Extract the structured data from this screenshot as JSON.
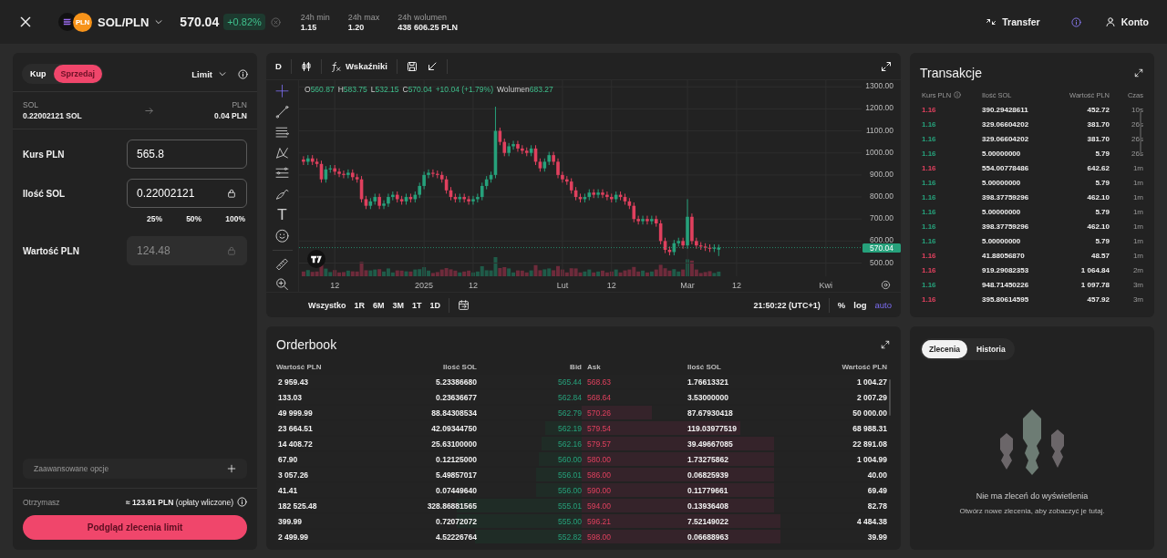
{
  "header": {
    "pair": "SOL/PLN",
    "quote_badge": "PLN",
    "price": "570.04",
    "change": "+0.82%",
    "stats": [
      {
        "label": "24h min",
        "value": "1.15"
      },
      {
        "label": "24h max",
        "value": "1.20"
      },
      {
        "label": "24h wolumen",
        "value": "438 606.25 PLN"
      }
    ],
    "actions": [
      {
        "kind": "transfer",
        "label": "Transfer"
      },
      {
        "kind": "info"
      },
      {
        "kind": "account",
        "label": "Konto"
      }
    ]
  },
  "order_form": {
    "sides": [
      {
        "label": "Kup",
        "selected": false
      },
      {
        "label": "Sprzedaj",
        "selected": true
      }
    ],
    "order_type": "Limit",
    "from": {
      "asset": "SOL",
      "balance": "0.22002121 SOL"
    },
    "to": {
      "asset": "PLN",
      "balance": "0.04 PLN"
    },
    "fields": [
      {
        "label": "Kurs PLN",
        "value": "565.8",
        "locked": false,
        "disabled": false
      },
      {
        "label": "Ilość SOL",
        "value": "0.22002121",
        "locked": true,
        "disabled": false,
        "presets": [
          "25%",
          "50%",
          "100%"
        ]
      },
      {
        "label": "Wartość PLN",
        "value": "124.48",
        "locked": true,
        "disabled": true
      }
    ],
    "advanced": "Zaawansowane opcje",
    "receive_label": "Otrzymasz",
    "receive_value": "**≈ 123.91 PLN** (opłaty wliczone)",
    "submit": "Podgląd zlecenia limit"
  },
  "chart": {
    "toolbar": {
      "interval": "D",
      "indicators": "Wskaźniki"
    },
    "text_tool": "T",
    "legend": [
      {
        "label": "O",
        "value": "560.87"
      },
      {
        "label": "H",
        "value": "583.75"
      },
      {
        "label": "L",
        "value": "532.15"
      },
      {
        "label": "C",
        "value": "570.04"
      }
    ],
    "legend_change": "+10.04 (+1.79%)",
    "volume_label": "Wolumen",
    "volume_value": "683.27",
    "chart_data": {
      "type": "candlestick",
      "grid": true,
      "ylim": [
        440,
        1330
      ],
      "yticks": [
        {
          "value": 500,
          "label": "500.00"
        },
        {
          "value": 600,
          "label": "600.00"
        },
        {
          "value": 700,
          "label": "700.00"
        },
        {
          "value": 800,
          "label": "800.00"
        },
        {
          "value": 900,
          "label": "900.00"
        },
        {
          "value": 1000,
          "label": "1000.00"
        },
        {
          "value": 1100,
          "label": "1100.00"
        },
        {
          "value": 1200,
          "label": "1200.00"
        },
        {
          "value": 1300,
          "label": "1300.00"
        }
      ],
      "ref_lines": [
        {
          "axis": "y",
          "value": 570.04,
          "label": "570.04"
        }
      ],
      "categories": [
        null,
        null,
        null,
        null,
        null,
        null,
        null,
        null,
        "12",
        null,
        null,
        null,
        null,
        null,
        null,
        null,
        null,
        null,
        null,
        null,
        null,
        null,
        null,
        null,
        null,
        null,
        null,
        null,
        "2025",
        null,
        null,
        null,
        null,
        null,
        null,
        null,
        null,
        null,
        null,
        "12",
        null,
        null,
        null,
        null,
        null,
        null,
        null,
        null,
        null,
        null,
        null,
        null,
        null,
        null,
        null,
        null,
        null,
        null,
        null,
        "Lut",
        null,
        null,
        null,
        null,
        null,
        null,
        null,
        null,
        null,
        null,
        "12",
        null,
        null,
        null,
        null,
        null,
        null,
        null,
        null,
        null,
        null,
        null,
        null,
        null,
        null,
        null,
        null,
        "Mar",
        null,
        null,
        null,
        null,
        null,
        null,
        null,
        null,
        null,
        null,
        "12",
        null,
        null,
        null,
        null,
        null,
        null,
        null,
        null,
        null,
        null,
        null,
        null,
        null,
        null,
        null,
        null,
        null,
        null,
        null,
        "Kwi",
        null,
        null,
        null,
        null,
        null,
        null,
        null
      ],
      "ohlc": [
        null,
        [
          970,
          985,
          945,
          960
        ],
        [
          960,
          990,
          945,
          975
        ],
        [
          975,
          990,
          945,
          960
        ],
        [
          960,
          975,
          935,
          950
        ],
        [
          950,
          965,
          865,
          880
        ],
        [
          880,
          940,
          865,
          925
        ],
        [
          925,
          945,
          910,
          930
        ],
        [
          930,
          945,
          900,
          915
        ],
        [
          915,
          930,
          890,
          905
        ],
        [
          905,
          920,
          885,
          900
        ],
        [
          900,
          925,
          885,
          910
        ],
        [
          910,
          925,
          875,
          890
        ],
        [
          890,
          905,
          865,
          880
        ],
        [
          880,
          895,
          775,
          790
        ],
        [
          790,
          805,
          745,
          760
        ],
        [
          760,
          795,
          745,
          780
        ],
        [
          780,
          815,
          765,
          800
        ],
        [
          800,
          815,
          745,
          760
        ],
        [
          760,
          785,
          745,
          770
        ],
        [
          770,
          815,
          755,
          800
        ],
        [
          800,
          825,
          785,
          810
        ],
        [
          810,
          825,
          775,
          790
        ],
        [
          790,
          805,
          765,
          780
        ],
        [
          780,
          815,
          765,
          800
        ],
        [
          800,
          815,
          775,
          790
        ],
        [
          790,
          825,
          775,
          810
        ],
        [
          810,
          865,
          795,
          850
        ],
        [
          850,
          915,
          835,
          900
        ],
        [
          900,
          925,
          885,
          910
        ],
        [
          910,
          925,
          890,
          905
        ],
        [
          905,
          920,
          885,
          900
        ],
        [
          900,
          915,
          865,
          880
        ],
        [
          880,
          895,
          815,
          830
        ],
        [
          830,
          845,
          785,
          800
        ],
        [
          800,
          815,
          775,
          790
        ],
        [
          790,
          815,
          775,
          800
        ],
        [
          800,
          815,
          775,
          790
        ],
        [
          790,
          805,
          765,
          780
        ],
        [
          780,
          805,
          765,
          790
        ],
        [
          790,
          815,
          775,
          800
        ],
        [
          800,
          865,
          785,
          850
        ],
        [
          850,
          895,
          835,
          880
        ],
        [
          880,
          915,
          865,
          900
        ],
        [
          900,
          1210,
          885,
          1100
        ],
        [
          1100,
          1115,
          1035,
          1050
        ],
        [
          1050,
          1065,
          985,
          1000
        ],
        [
          1000,
          1045,
          985,
          1030
        ],
        [
          1030,
          1055,
          1015,
          1040
        ],
        [
          1040,
          1055,
          1005,
          1020
        ],
        [
          1020,
          1035,
          995,
          1010
        ],
        [
          1010,
          1025,
          985,
          1000
        ],
        [
          1000,
          1035,
          985,
          1020
        ],
        [
          1020,
          1035,
          945,
          960
        ],
        [
          960,
          975,
          915,
          930
        ],
        [
          930,
          975,
          915,
          960
        ],
        [
          960,
          1005,
          945,
          990
        ],
        [
          990,
          1005,
          945,
          960
        ],
        [
          960,
          975,
          885,
          900
        ],
        [
          900,
          915,
          865,
          880
        ],
        [
          880,
          895,
          855,
          870
        ],
        [
          870,
          885,
          815,
          830
        ],
        [
          830,
          845,
          785,
          800
        ],
        [
          800,
          815,
          775,
          790
        ],
        [
          790,
          815,
          775,
          800
        ],
        [
          800,
          835,
          785,
          820
        ],
        [
          820,
          835,
          795,
          810
        ],
        [
          810,
          835,
          795,
          820
        ],
        [
          820,
          835,
          795,
          810
        ],
        [
          810,
          825,
          785,
          800
        ],
        [
          800,
          815,
          775,
          790
        ],
        [
          790,
          825,
          775,
          810
        ],
        [
          810,
          825,
          785,
          800
        ],
        [
          800,
          815,
          765,
          780
        ],
        [
          780,
          795,
          745,
          760
        ],
        [
          760,
          775,
          685,
          700
        ],
        [
          700,
          715,
          675,
          690
        ],
        [
          690,
          715,
          675,
          700
        ],
        [
          700,
          715,
          675,
          690
        ],
        [
          690,
          715,
          675,
          700
        ],
        [
          700,
          715,
          665,
          680
        ],
        [
          680,
          695,
          585,
          600
        ],
        [
          600,
          615,
          545,
          560
        ],
        [
          560,
          575,
          535,
          550
        ],
        [
          550,
          605,
          535,
          590
        ],
        [
          590,
          615,
          575,
          600
        ],
        [
          600,
          615,
          565,
          580
        ],
        [
          580,
          790,
          565,
          710
        ],
        [
          710,
          725,
          585,
          600
        ],
        [
          600,
          615,
          565,
          580
        ],
        [
          580,
          595,
          560,
          575
        ],
        [
          575,
          590,
          555,
          570
        ],
        [
          570,
          585,
          550,
          565
        ],
        [
          565,
          585,
          550,
          570
        ],
        [
          561,
          584,
          532,
          570
        ],
        null,
        null,
        null,
        null,
        null,
        null,
        null,
        null,
        null,
        null,
        null,
        null,
        null,
        null,
        null,
        null,
        null,
        null,
        null,
        null,
        null,
        null,
        null,
        null,
        null,
        null,
        null,
        null,
        null,
        null,
        null
      ]
    },
    "ranges": [
      "Wszystko",
      "1R",
      "6M",
      "3M",
      "1T",
      "1D"
    ],
    "clock": "21:50:22 (UTC+1)",
    "scales": [
      {
        "label": "%",
        "selected": false
      },
      {
        "label": "log",
        "selected": false
      },
      {
        "label": "auto",
        "selected": true
      }
    ]
  },
  "trades": {
    "title": "Transakcje",
    "columns": [
      "Kurs PLN",
      "Ilość SOL",
      "Wartość PLN",
      "Czas"
    ],
    "rows": [
      {
        "color": "#e0405e",
        "price": "1.16",
        "amount": "390.29428611",
        "value": "452.72",
        "time": "10s"
      },
      {
        "color": "#26a17b",
        "price": "1.16",
        "amount": "329.06604202",
        "value": "381.70",
        "time": "26s"
      },
      {
        "color": "#26a17b",
        "price": "1.16",
        "amount": "329.06604202",
        "value": "381.70",
        "time": "26s"
      },
      {
        "color": "#26a17b",
        "price": "1.16",
        "amount": "5.00000000",
        "value": "5.79",
        "time": "26s"
      },
      {
        "color": "#e0405e",
        "price": "1.16",
        "amount": "554.00778486",
        "value": "642.62",
        "time": "1m"
      },
      {
        "color": "#26a17b",
        "price": "1.16",
        "amount": "5.00000000",
        "value": "5.79",
        "time": "1m"
      },
      {
        "color": "#26a17b",
        "price": "1.16",
        "amount": "398.37759296",
        "value": "462.10",
        "time": "1m"
      },
      {
        "color": "#26a17b",
        "price": "1.16",
        "amount": "5.00000000",
        "value": "5.79",
        "time": "1m"
      },
      {
        "color": "#26a17b",
        "price": "1.16",
        "amount": "398.37759296",
        "value": "462.10",
        "time": "1m"
      },
      {
        "color": "#26a17b",
        "price": "1.16",
        "amount": "5.00000000",
        "value": "5.79",
        "time": "1m"
      },
      {
        "color": "#e0405e",
        "price": "1.16",
        "amount": "41.88056870",
        "value": "48.57",
        "time": "1m"
      },
      {
        "color": "#e0405e",
        "price": "1.16",
        "amount": "919.29082353",
        "value": "1 064.84",
        "time": "2m"
      },
      {
        "color": "#26a17b",
        "price": "1.16",
        "amount": "948.71450226",
        "value": "1 097.78",
        "time": "3m"
      },
      {
        "color": "#e0405e",
        "price": "1.16",
        "amount": "395.80614595",
        "value": "457.92",
        "time": "3m"
      }
    ]
  },
  "orderbook": {
    "title": "Orderbook",
    "columns": [
      "Wartość PLN",
      "Ilość SOL",
      "Bid",
      "Ask",
      "Ilość SOL",
      "Wartość PLN"
    ],
    "rows": [
      {
        "bid_value": "2 959.43",
        "bid_amount": "5.23386680",
        "bid": {
          "price": "565.44"
        },
        "ask": {
          "price": "568.63"
        },
        "ask_amount": "1.76613321",
        "ask_value": "1 004.27"
      },
      {
        "bid_value": "133.03",
        "bid_amount": "0.23636677",
        "bid": {
          "price": "562.84"
        },
        "ask": {
          "price": "568.64"
        },
        "ask_amount": "3.53000000",
        "ask_value": "2 007.29"
      },
      {
        "bid_value": "49 999.99",
        "bid_amount": "88.84308534",
        "bid": {
          "price": "562.79"
        },
        "ask": {
          "price": "570.26",
          "level": 0.23
        },
        "ask_amount": "87.67930418",
        "ask_value": "50 000.00"
      },
      {
        "bid_value": "23 664.51",
        "bid_amount": "42.09344750",
        "bid": {
          "price": "562.19",
          "level": 0.12
        },
        "ask": {
          "price": "579.54",
          "level": 0.52
        },
        "ask_amount": "119.03977519",
        "ask_value": "68 988.31"
      },
      {
        "bid_value": "14 408.72",
        "bid_amount": "25.63100000",
        "bid": {
          "price": "562.16",
          "level": 0.13
        },
        "ask": {
          "price": "579.57",
          "level": 0.63
        },
        "ask_amount": "39.49667085",
        "ask_value": "22 891.08"
      },
      {
        "bid_value": "67.90",
        "bid_amount": "0.12125000",
        "bid": {
          "price": "560.00",
          "level": 0.14
        },
        "ask": {
          "price": "580.00",
          "level": 0.63
        },
        "ask_amount": "1.73275862",
        "ask_value": "1 004.99"
      },
      {
        "bid_value": "3 057.26",
        "bid_amount": "5.49857017",
        "bid": {
          "price": "556.01",
          "level": 0.15
        },
        "ask": {
          "price": "586.00",
          "level": 0.63
        },
        "ask_amount": "0.06825939",
        "ask_value": "40.00"
      },
      {
        "bid_value": "41.41",
        "bid_amount": "0.07449640",
        "bid": {
          "price": "556.00",
          "level": 0.15
        },
        "ask": {
          "price": "590.00",
          "level": 0.63
        },
        "ask_amount": "0.11779661",
        "ask_value": "69.49"
      },
      {
        "bid_value": "182 525.48",
        "bid_amount": "328.86881565",
        "bid": {
          "price": "555.01",
          "level": 0.41
        },
        "ask": {
          "price": "594.00",
          "level": 0.63
        },
        "ask_amount": "0.13936408",
        "ask_value": "82.78"
      },
      {
        "bid_value": "399.99",
        "bid_amount": "0.72072072",
        "bid": {
          "price": "555.00",
          "level": 0.41
        },
        "ask": {
          "price": "596.21",
          "level": 0.65
        },
        "ask_amount": "7.52149022",
        "ask_value": "4 484.38"
      },
      {
        "bid_value": "2 499.99",
        "bid_amount": "4.52226764",
        "bid": {
          "price": "552.82",
          "level": 0.35
        },
        "ask": {
          "price": "598.00",
          "level": 0.65
        },
        "ask_amount": "0.06688963",
        "ask_value": "39.99"
      }
    ]
  },
  "orders": {
    "tabs": [
      {
        "label": "Zlecenia",
        "selected": true
      },
      {
        "label": "Historia",
        "selected": false
      }
    ],
    "empty_title": "Nie ma zleceń do wyświetlenia",
    "empty_text": "Otwórz nowe zlecenia, aby zobaczyć je tutaj."
  }
}
